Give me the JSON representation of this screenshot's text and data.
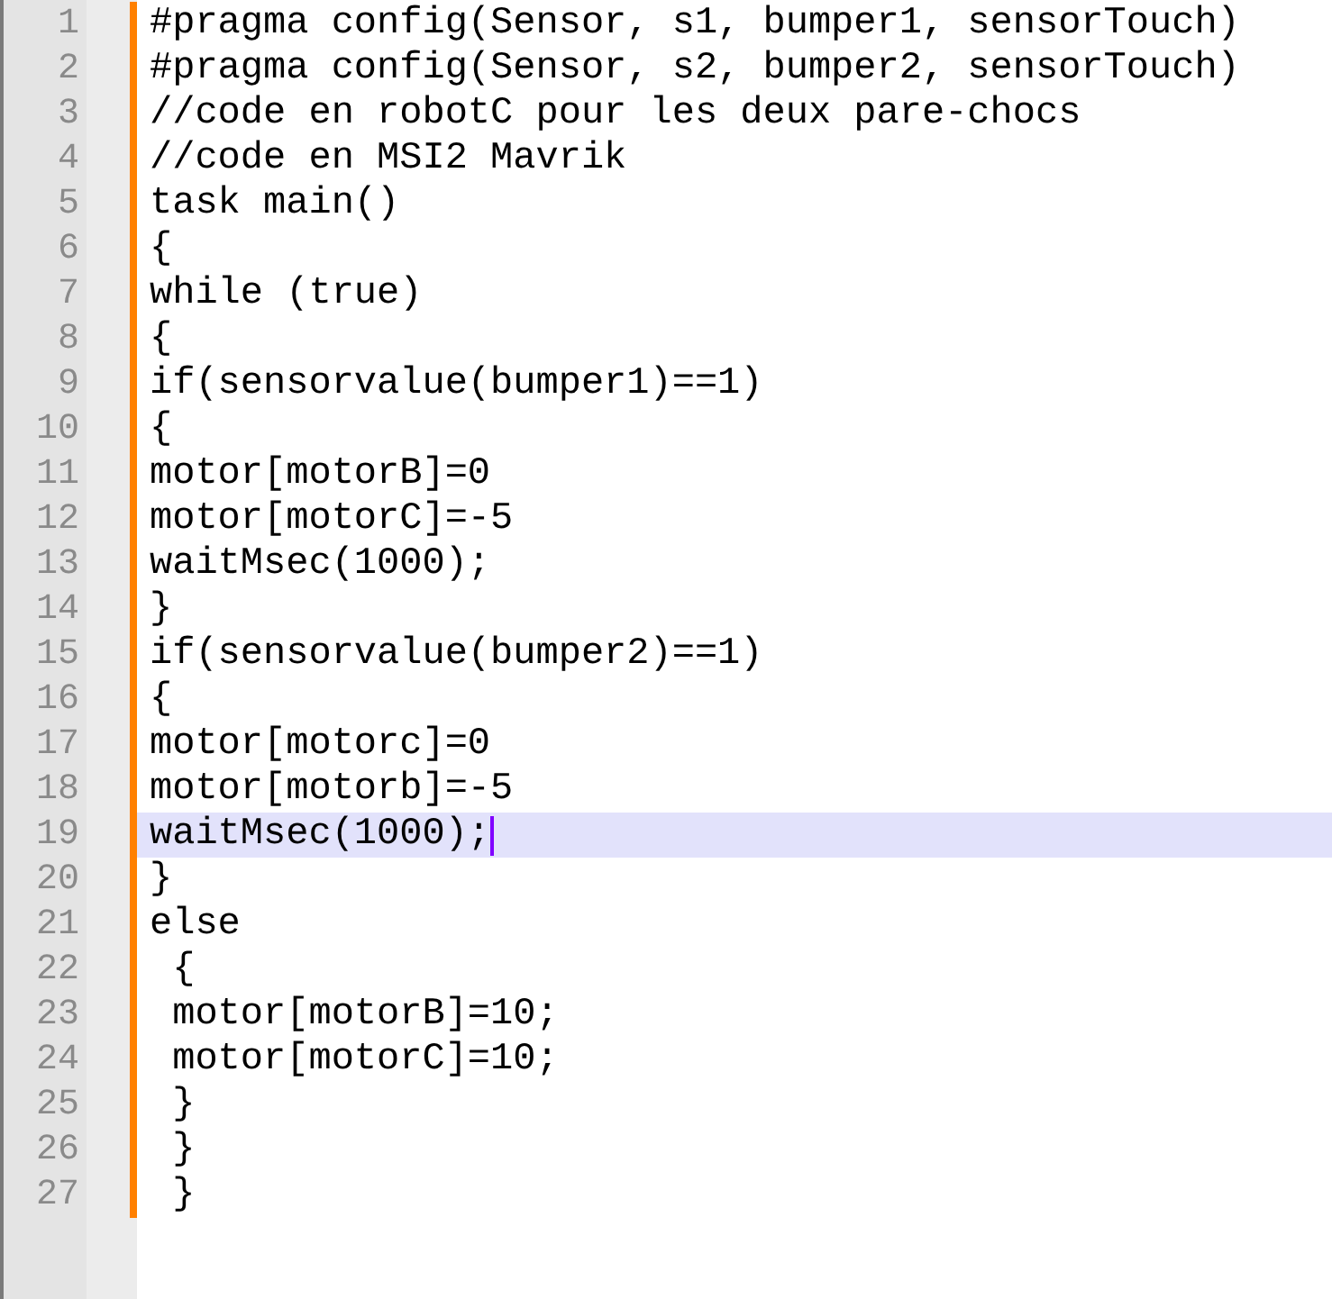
{
  "editor": {
    "lines": [
      {
        "number": "1",
        "text": "#pragma config(Sensor, s1, bumper1, sensorTouch)",
        "current": false
      },
      {
        "number": "2",
        "text": "#pragma config(Sensor, s2, bumper2, sensorTouch)",
        "current": false
      },
      {
        "number": "3",
        "text": "//code en robotC pour les deux pare-chocs",
        "current": false
      },
      {
        "number": "4",
        "text": "//code en MSI2 Mavrik",
        "current": false
      },
      {
        "number": "5",
        "text": "task main()",
        "current": false
      },
      {
        "number": "6",
        "text": "{",
        "current": false
      },
      {
        "number": "7",
        "text": "while (true)",
        "current": false
      },
      {
        "number": "8",
        "text": "{",
        "current": false
      },
      {
        "number": "9",
        "text": "if(sensorvalue(bumper1)==1)",
        "current": false
      },
      {
        "number": "10",
        "text": "{",
        "current": false
      },
      {
        "number": "11",
        "text": "motor[motorB]=0",
        "current": false
      },
      {
        "number": "12",
        "text": "motor[motorC]=-5",
        "current": false
      },
      {
        "number": "13",
        "text": "waitMsec(1000);",
        "current": false
      },
      {
        "number": "14",
        "text": "}",
        "current": false
      },
      {
        "number": "15",
        "text": "if(sensorvalue(bumper2)==1)",
        "current": false
      },
      {
        "number": "16",
        "text": "{",
        "current": false
      },
      {
        "number": "17",
        "text": "motor[motorc]=0",
        "current": false
      },
      {
        "number": "18",
        "text": "motor[motorb]=-5",
        "current": false
      },
      {
        "number": "19",
        "text": "waitMsec(1000);",
        "current": true
      },
      {
        "number": "20",
        "text": "}",
        "current": false
      },
      {
        "number": "21",
        "text": "else",
        "current": false
      },
      {
        "number": "22",
        "text": " {",
        "current": false
      },
      {
        "number": "23",
        "text": " motor[motorB]=10;",
        "current": false
      },
      {
        "number": "24",
        "text": " motor[motorC]=10;",
        "current": false
      },
      {
        "number": "25",
        "text": " }",
        "current": false
      },
      {
        "number": "26",
        "text": " }",
        "current": false
      },
      {
        "number": "27",
        "text": " }",
        "current": false
      }
    ]
  }
}
